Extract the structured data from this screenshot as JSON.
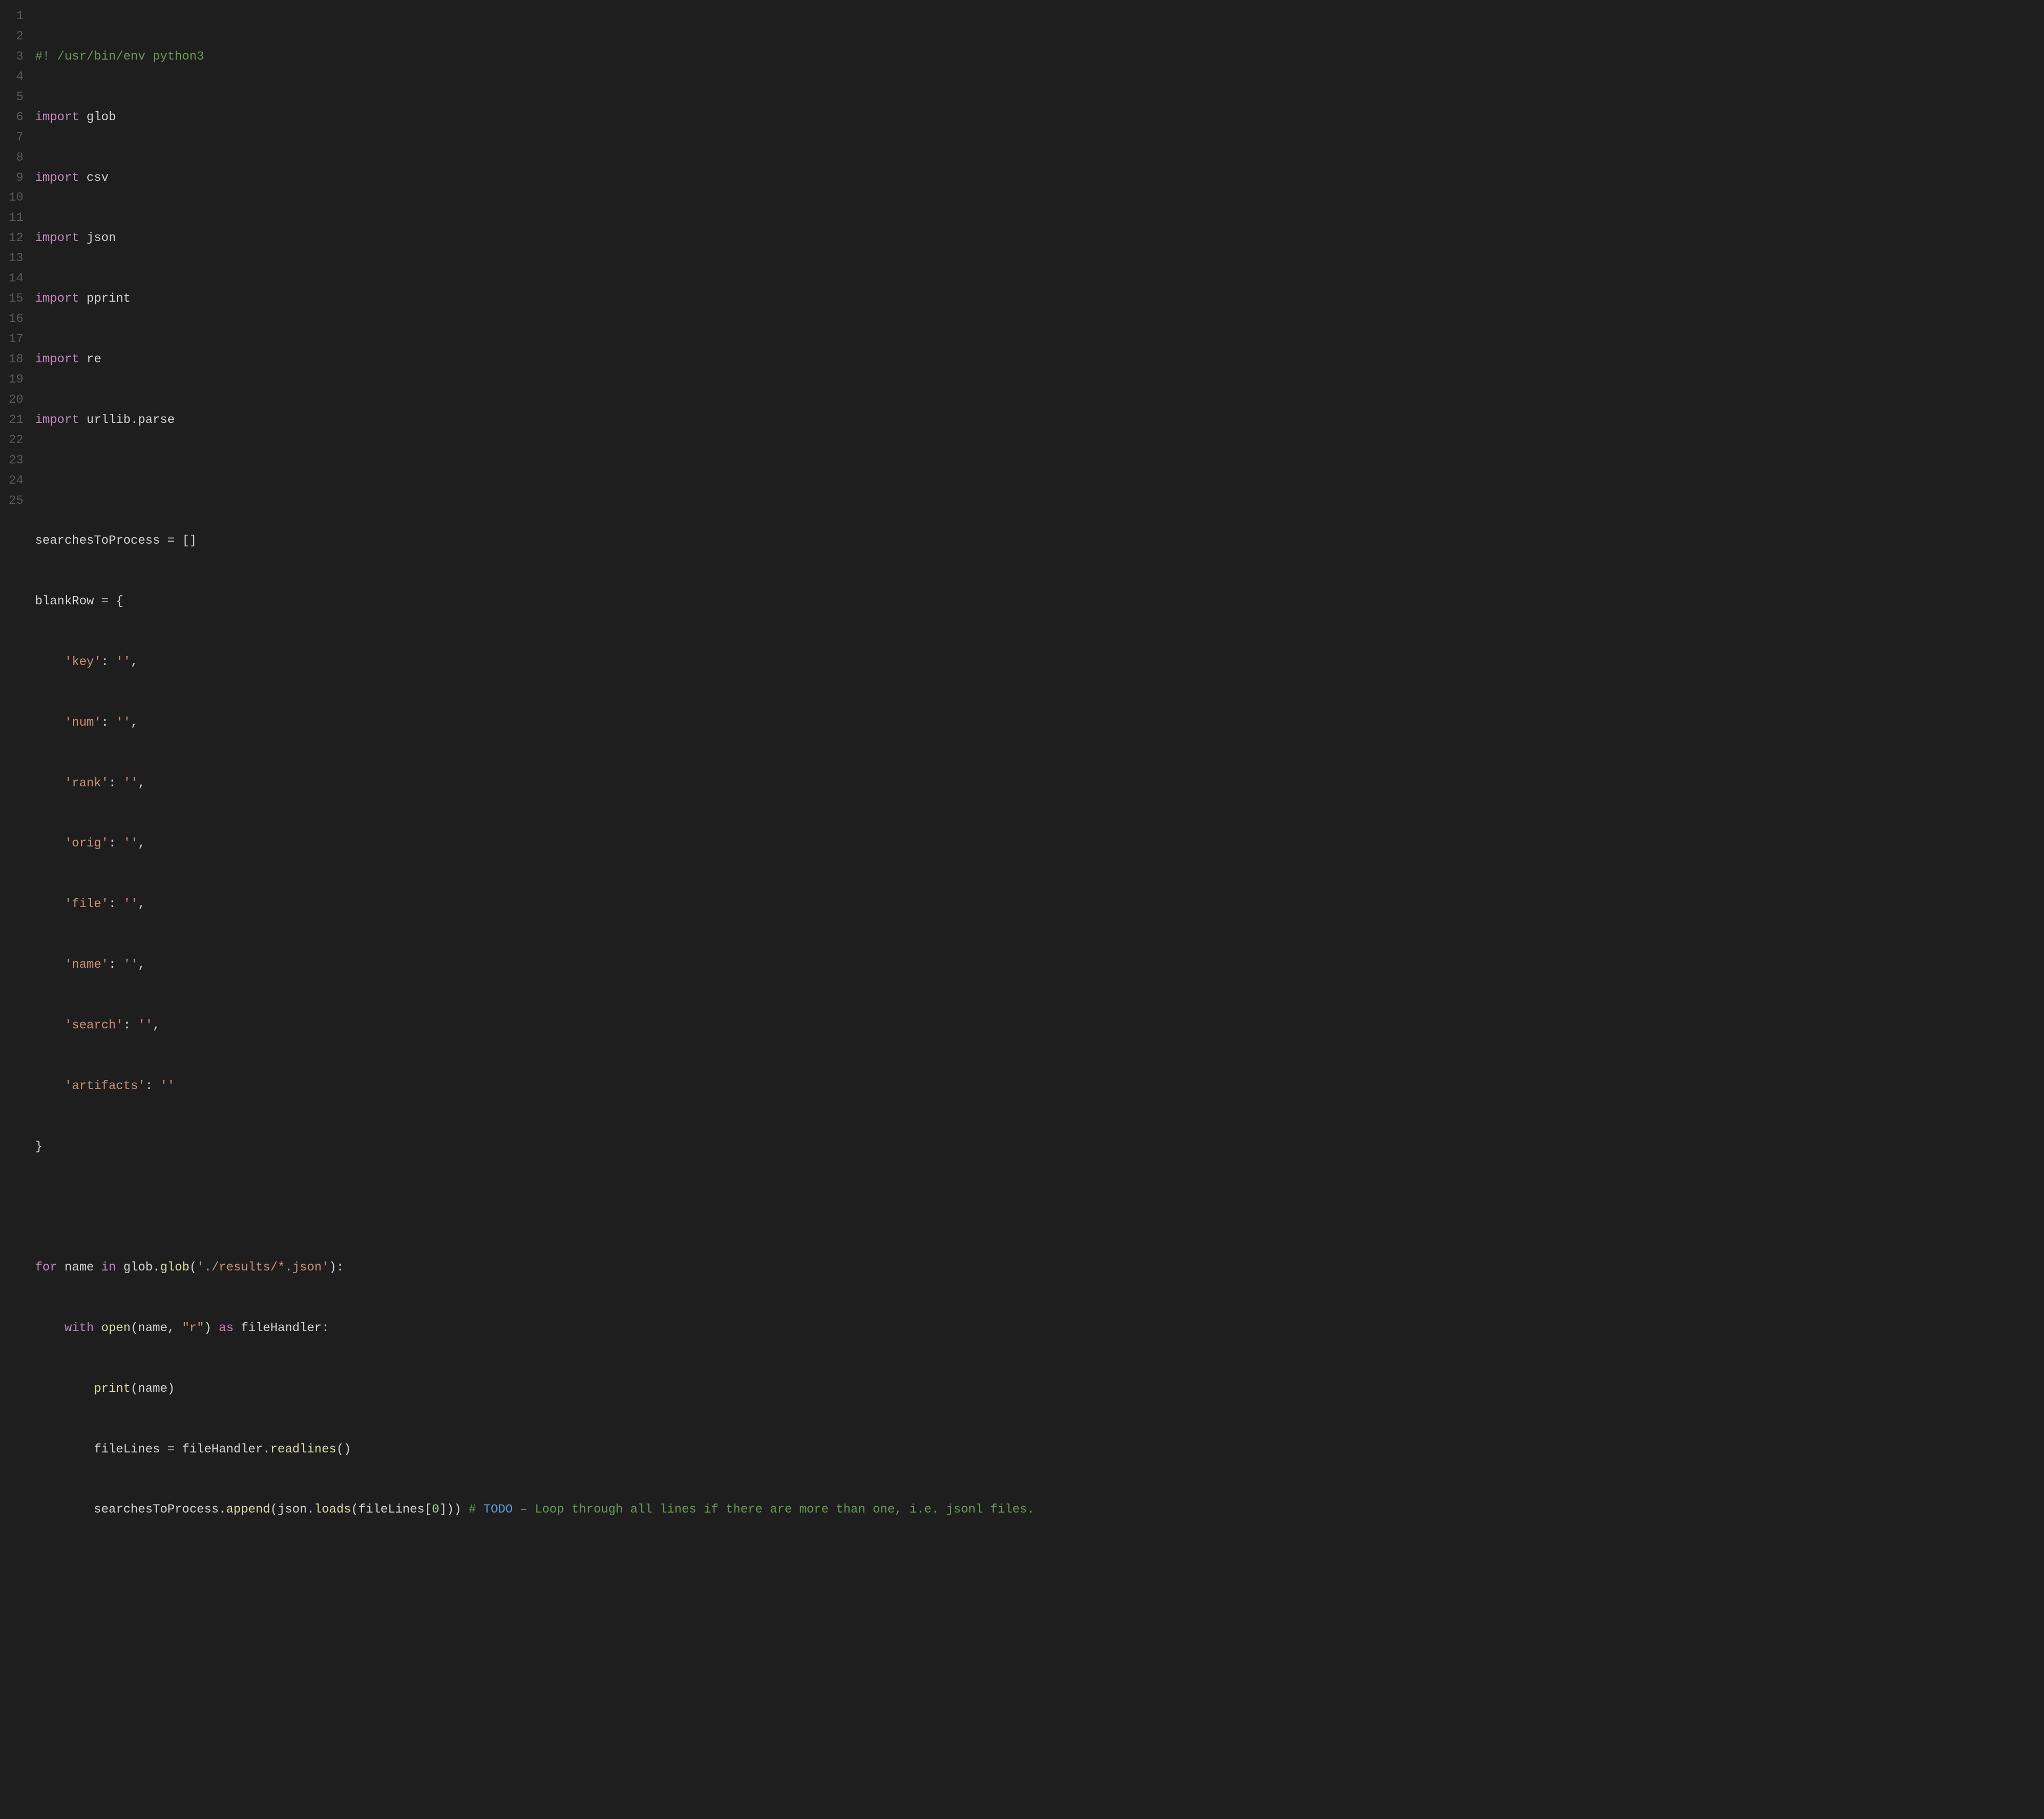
{
  "editor": {
    "language": "python",
    "line_start": 1,
    "line_count": 25,
    "gutter": [
      "1",
      "2",
      "3",
      "4",
      "5",
      "6",
      "7",
      "8",
      "9",
      "10",
      "11",
      "12",
      "13",
      "14",
      "15",
      "16",
      "17",
      "18",
      "19",
      "20",
      "21",
      "22",
      "23",
      "24",
      "25"
    ],
    "code": {
      "shebang": "#! /usr/bin/env python3",
      "import_kw": "import",
      "modules": [
        "glob",
        "csv",
        "json",
        "pprint",
        "re",
        "urllib.parse"
      ],
      "var_searches": "searchesToProcess",
      "equals": " = ",
      "empty_list": "[]",
      "var_blankrow": "blankRow",
      "brace_open": " = {",
      "dict_keys": [
        "'key'",
        "'num'",
        "'rank'",
        "'orig'",
        "'file'",
        "'name'",
        "'search'",
        "'artifacts'"
      ],
      "dict_sep": ": ",
      "dict_val": "''",
      "comma": ",",
      "brace_close": "}",
      "for_kw": "for",
      "for_var": "name",
      "in_kw": "in",
      "glob_call_pre": "glob.",
      "glob_fn": "glob",
      "glob_arg": "'./results/*.json'",
      "for_colon": ":",
      "with_kw": "with",
      "open_fn": "open",
      "open_arg1": "name",
      "open_arg2": "\"r\"",
      "as_kw": "as",
      "handler": "fileHandler",
      "with_colon": ":",
      "print_fn": "print",
      "print_arg": "name",
      "var_filelines": "fileLines",
      "handler_readlines": "fileHandler.",
      "readlines_fn": "readlines",
      "readlines_parens": "()",
      "append_target": "searchesToProcess.",
      "append_fn": "append",
      "json_loads_pre": "json.",
      "loads_fn": "loads",
      "idx_pre": "fileLines[",
      "idx_num": "0",
      "idx_post": "]",
      "todo_hash": "# ",
      "todo_label": "TODO",
      "todo_dash": " – ",
      "todo_rest": "Loop through all lines if there are more than one, i.e. jsonl files."
    }
  }
}
